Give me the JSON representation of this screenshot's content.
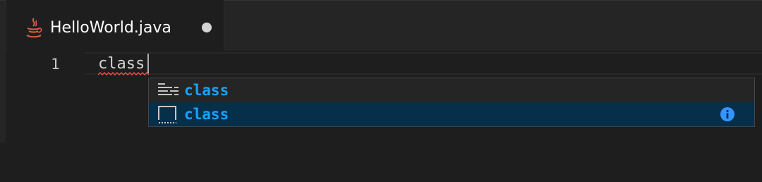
{
  "tab": {
    "filename": "HelloWorld.java",
    "file_icon": "java-coffee-icon",
    "dirty_indicator": "unsaved-dot-icon"
  },
  "editor": {
    "line_number": "1",
    "code": "class"
  },
  "suggest": {
    "items": [
      {
        "label": "class",
        "icon": "keyword-icon",
        "focused": false
      },
      {
        "label": "class",
        "icon": "snippet-icon",
        "focused": true
      }
    ],
    "info_icon": "info-icon"
  },
  "colors": {
    "editor_background": "#1e1e1e",
    "tab_bar_background": "#252526",
    "suggest_highlight": "#18a3ff",
    "focused_row_background": "#062f4a",
    "error_squiggle": "#f14c4c",
    "info_icon": "#3794ff"
  }
}
